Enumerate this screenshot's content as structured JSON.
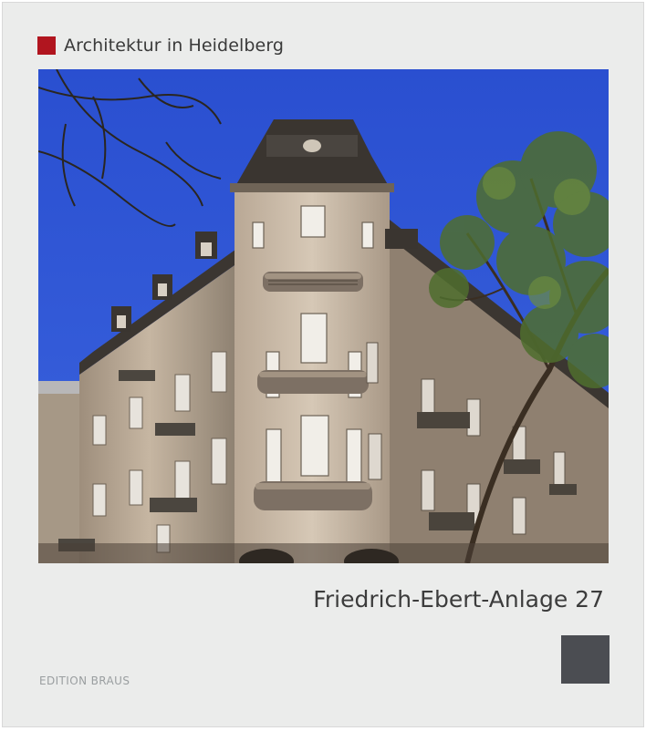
{
  "series": {
    "label": "Architektur in Heidelberg",
    "accent_color": "#b1151f"
  },
  "photo": {
    "subject": "building-photo"
  },
  "title": "Friedrich-Ebert-Anlage 27",
  "publisher": "EDITION BRAUS",
  "colors": {
    "background": "#ebeceb",
    "logo_block": "#4b4d52",
    "sky": "#2f56d4"
  }
}
